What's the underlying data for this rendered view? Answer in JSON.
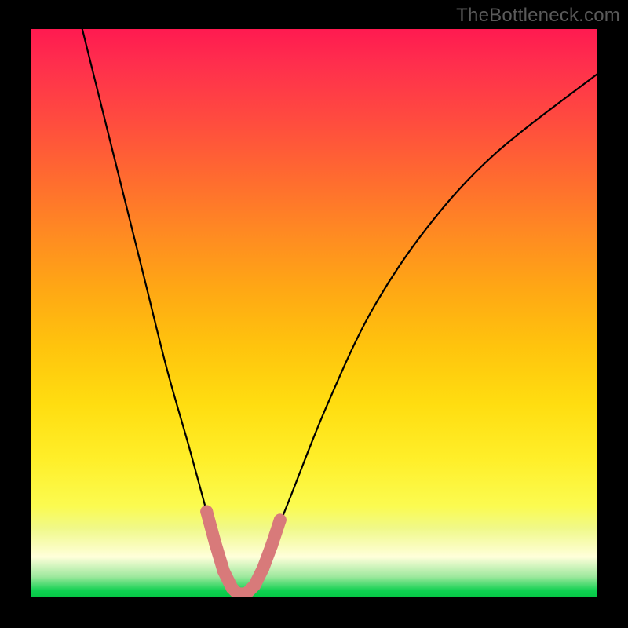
{
  "watermark": "TheBottleneck.com",
  "chart_data": {
    "type": "line",
    "title": "",
    "xlabel": "",
    "ylabel": "",
    "xlim": [
      0,
      100
    ],
    "ylim": [
      0,
      100
    ],
    "series": [
      {
        "name": "bottleneck-curve",
        "x": [
          9,
          12,
          16,
          20,
          24,
          28,
          31,
          33,
          35,
          36.5,
          38,
          40,
          42,
          46,
          52,
          60,
          70,
          82,
          100
        ],
        "values": [
          100,
          88,
          72,
          56,
          40,
          26,
          15,
          8,
          3,
          0.5,
          0.5,
          3,
          8,
          18,
          33,
          50,
          65,
          78,
          92
        ]
      }
    ],
    "markers": {
      "name": "highlight-segments",
      "color": "#d87a7a",
      "points": [
        {
          "x": 31.0,
          "y": 15.0
        },
        {
          "x": 32.5,
          "y": 9.5
        },
        {
          "x": 34.0,
          "y": 4.5
        },
        {
          "x": 35.5,
          "y": 1.5
        },
        {
          "x": 36.5,
          "y": 0.5
        },
        {
          "x": 38.0,
          "y": 0.5
        },
        {
          "x": 39.5,
          "y": 2.0
        },
        {
          "x": 41.0,
          "y": 5.0
        },
        {
          "x": 42.5,
          "y": 9.0
        },
        {
          "x": 44.0,
          "y": 13.5
        }
      ]
    },
    "gradient_stops": [
      {
        "pos": 0,
        "color": "#ff1a50"
      },
      {
        "pos": 50,
        "color": "#ffc40d"
      },
      {
        "pos": 88,
        "color": "#f0f98a"
      },
      {
        "pos": 100,
        "color": "#06c846"
      }
    ]
  }
}
